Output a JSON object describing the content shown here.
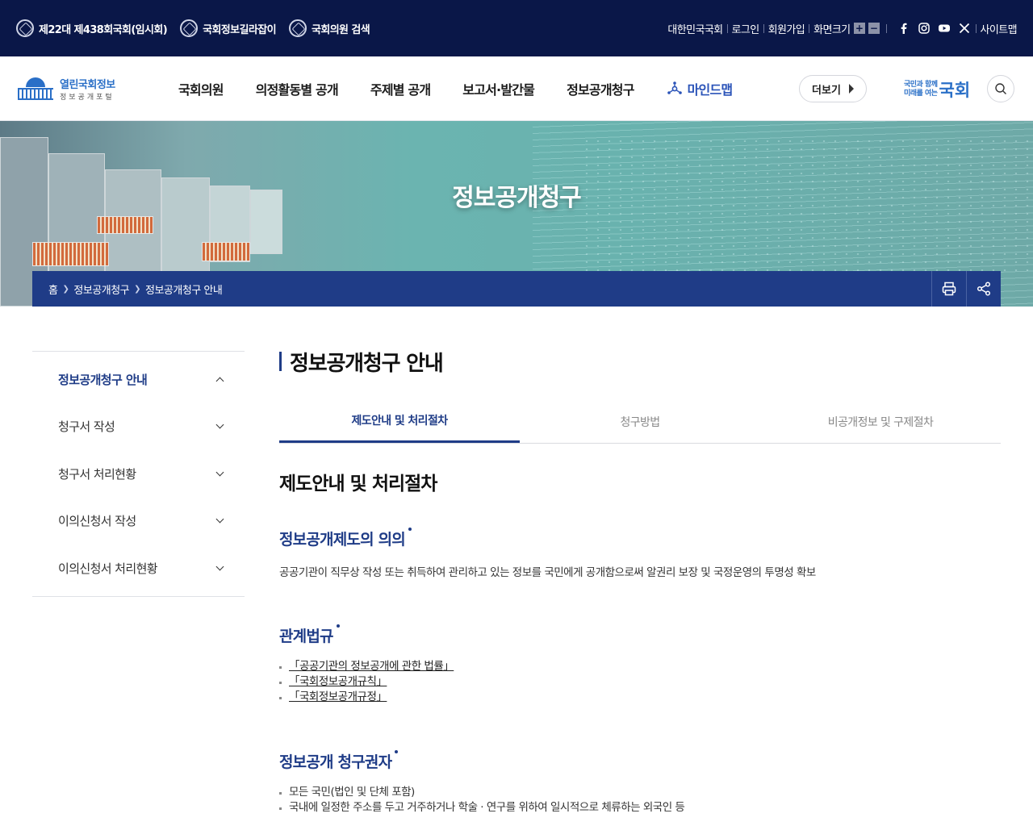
{
  "topbar": {
    "left": [
      "제22대 제438회국회(임시회)",
      "국회정보길라잡이",
      "국회의원 검색"
    ],
    "right": [
      "대한민국국회",
      "로그인",
      "회원가입",
      "화면크기"
    ],
    "sitemap": "사이트맵",
    "size_plus": "+",
    "size_minus": "−"
  },
  "header": {
    "logo_title": "열린국회정보",
    "logo_sub": "정보공개포털",
    "nav": [
      "국회의원",
      "의정활동별 공개",
      "주제별 공개",
      "보고서·발간물",
      "정보공개청구"
    ],
    "mindmap": "마인드맵",
    "more": "더보기",
    "slogan_small_1": "국민과 함께",
    "slogan_small_2": "미래를 여는",
    "slogan_big": "국회"
  },
  "visual": {
    "title": "정보공개청구",
    "breadcrumb": [
      "홈",
      "정보공개청구",
      "정보공개청구 안내"
    ]
  },
  "sidenav": {
    "items": [
      {
        "label": "정보공개청구 안내",
        "active": true
      },
      {
        "label": "청구서 작성",
        "active": false
      },
      {
        "label": "청구서 처리현황",
        "active": false
      },
      {
        "label": "이의신청서 작성",
        "active": false
      },
      {
        "label": "이의신청서 처리현황",
        "active": false
      }
    ]
  },
  "content": {
    "page_title": "정보공개청구 안내",
    "tabs": [
      "제도안내 및 처리절차",
      "청구방법",
      "비공개정보 및 구제절차"
    ],
    "heading": "제도안내 및 처리절차",
    "sections": {
      "meaning": {
        "title": "정보공개제도의 의의",
        "text": "공공기관이 직무상 작성 또는 취득하여 관리하고 있는 정보를 국민에게 공개함으로써 알권리 보장 및 국정운영의 투명성 확보"
      },
      "laws": {
        "title": "관계법규",
        "items": [
          "「공공기관의 정보공개에 관한 법률」",
          "「국회정보공개규칙」",
          "「국회정보공개규정」"
        ]
      },
      "claimants": {
        "title": "정보공개 청구권자",
        "items": [
          "모든 국민(법인 및 단체 포함)",
          "국내에 일정한 주소를 두고 거주하거나 학술 · 연구를 위하여 일시적으로 체류하는 외국인 등"
        ]
      }
    }
  },
  "colors": {
    "topbar": "#0a1748",
    "accent": "#1f3c87",
    "brand_blue": "#2a6fc7"
  }
}
